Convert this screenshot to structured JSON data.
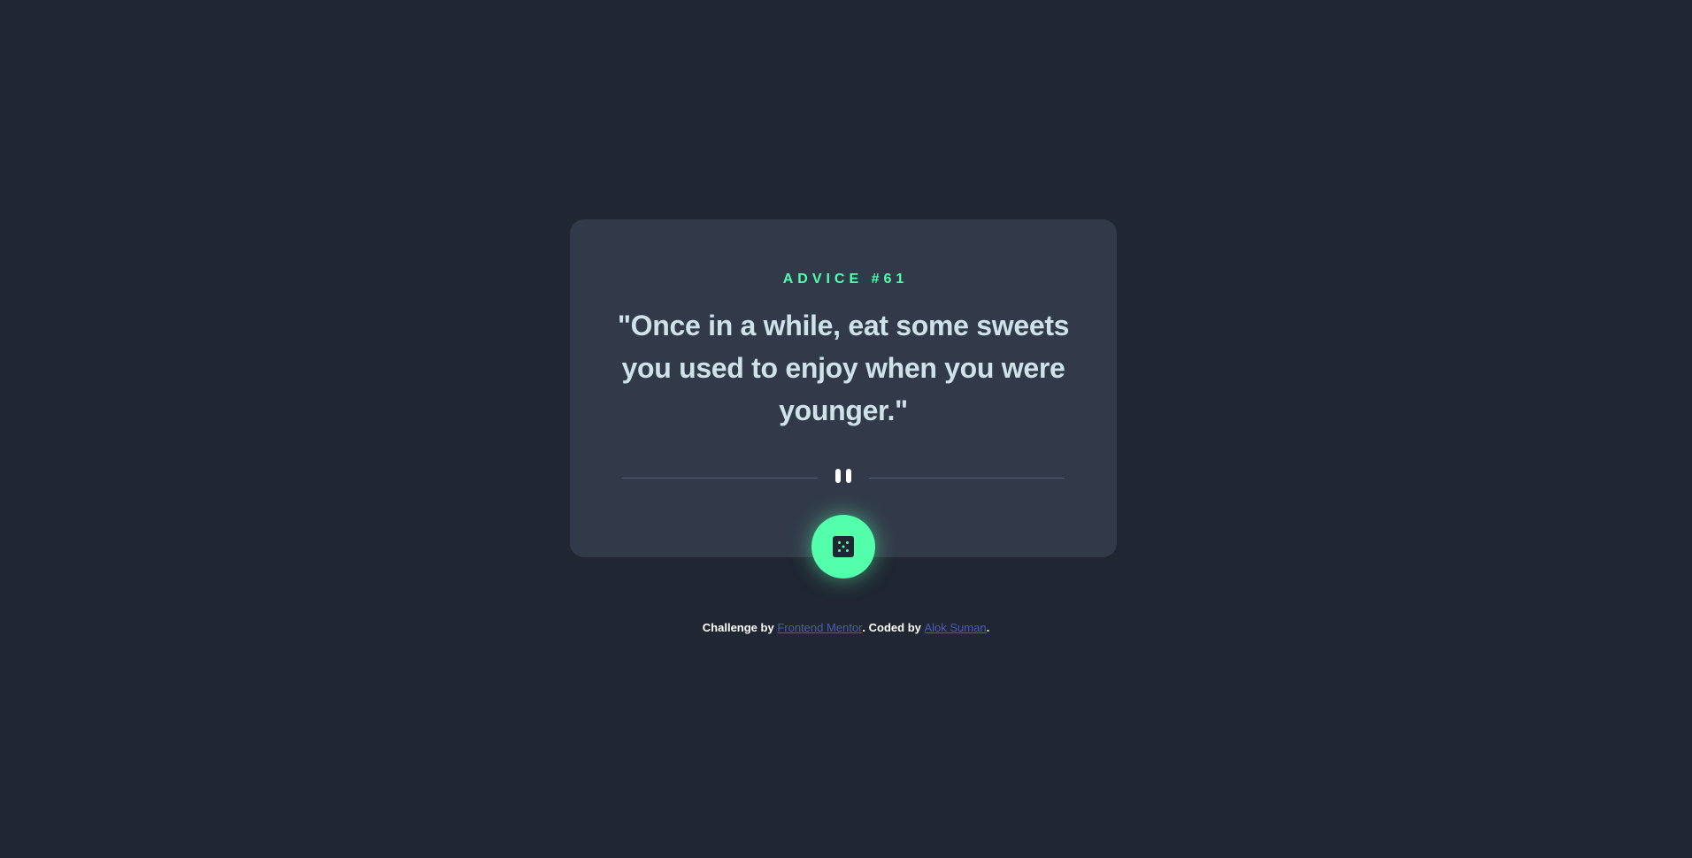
{
  "advice": {
    "id_label": "ADVICE #61",
    "text": "\"Once in a while, eat some sweets you used to enjoy when you were younger.\""
  },
  "divider": {
    "icon": "pause-icon"
  },
  "dice_button": {
    "icon": "dice-icon"
  },
  "footer": {
    "prefix": "Challenge by ",
    "link1": "Frontend Mentor",
    "middle": ". Coded by ",
    "link2": "Alok Suman",
    "suffix": "."
  },
  "colors": {
    "background": "#202632",
    "card": "#323a49",
    "accent": "#53ffab",
    "text": "#cee3e9",
    "link": "#4b5ab5"
  }
}
